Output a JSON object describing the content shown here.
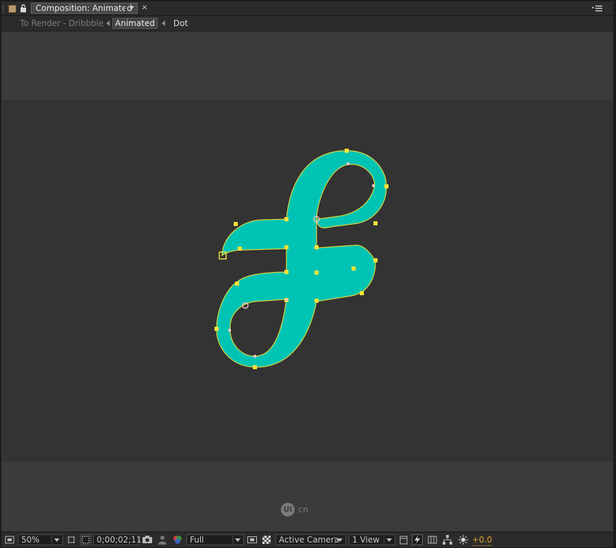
{
  "titlebar": {
    "panel_tab_label": "Composition: Animated",
    "close_glyph": "×",
    "icons": [
      "grip-icon",
      "lock-icon",
      "chevron-down-icon",
      "close-icon",
      "panel-menu-icon"
    ]
  },
  "breadcrumbs": {
    "items": [
      "To Render - Dribbble",
      "Animated",
      "Dot"
    ],
    "active_index": 1
  },
  "viewer": {
    "shape_fill": "#00c4b3",
    "path_color": "#e0d93c",
    "vertex_color": "#f2e23c",
    "pasteboard_color": "#3b3b3b",
    "composition_bg": "#333333",
    "watermark_logo": "UI",
    "watermark_text": "cn"
  },
  "toolbar": {
    "magnification": "50%",
    "timecode": "0;00;02;11",
    "resolution": "Full",
    "camera": "Active Camera",
    "view_layout": "1 View",
    "exposure": "+0.0",
    "exposure_color": "#e5a329",
    "icons": [
      "always-preview-icon",
      "grid-guides-icon",
      "region-of-interest-icon",
      "snapshot-icon",
      "show-snapshot-icon",
      "rgb-channels-icon",
      "fast-previews-icon",
      "transparency-grid-icon",
      "timeline-icon",
      "flowchart-icon",
      "reset-exposure-icon"
    ]
  }
}
